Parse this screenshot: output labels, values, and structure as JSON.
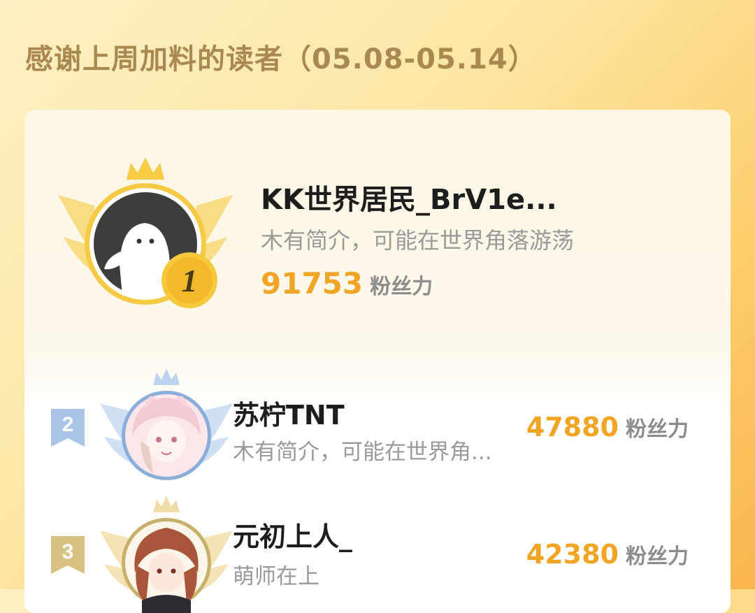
{
  "header": {
    "title": "感谢上周加料的读者（05.08-05.14）"
  },
  "leaderboard": {
    "first": {
      "rank": "1",
      "name": "KK世界居民_BrV1e...",
      "intro": "木有简介，可能在世界角落游荡",
      "fans_value": "91753",
      "fans_unit": "粉丝力"
    },
    "rows": [
      {
        "rank": "2",
        "name": "苏柠TNT",
        "intro": "木有简介，可能在世界角...",
        "fans_value": "47880",
        "fans_unit": "粉丝力"
      },
      {
        "rank": "3",
        "name": "元初上人_",
        "intro": "萌师在上",
        "fans_value": "42380",
        "fans_unit": "粉丝力"
      }
    ]
  },
  "colors": {
    "accent": "#f2a425",
    "gold": "#f3c94a",
    "silver_blue": "#a9c4e6",
    "bronze": "#d8c283"
  }
}
